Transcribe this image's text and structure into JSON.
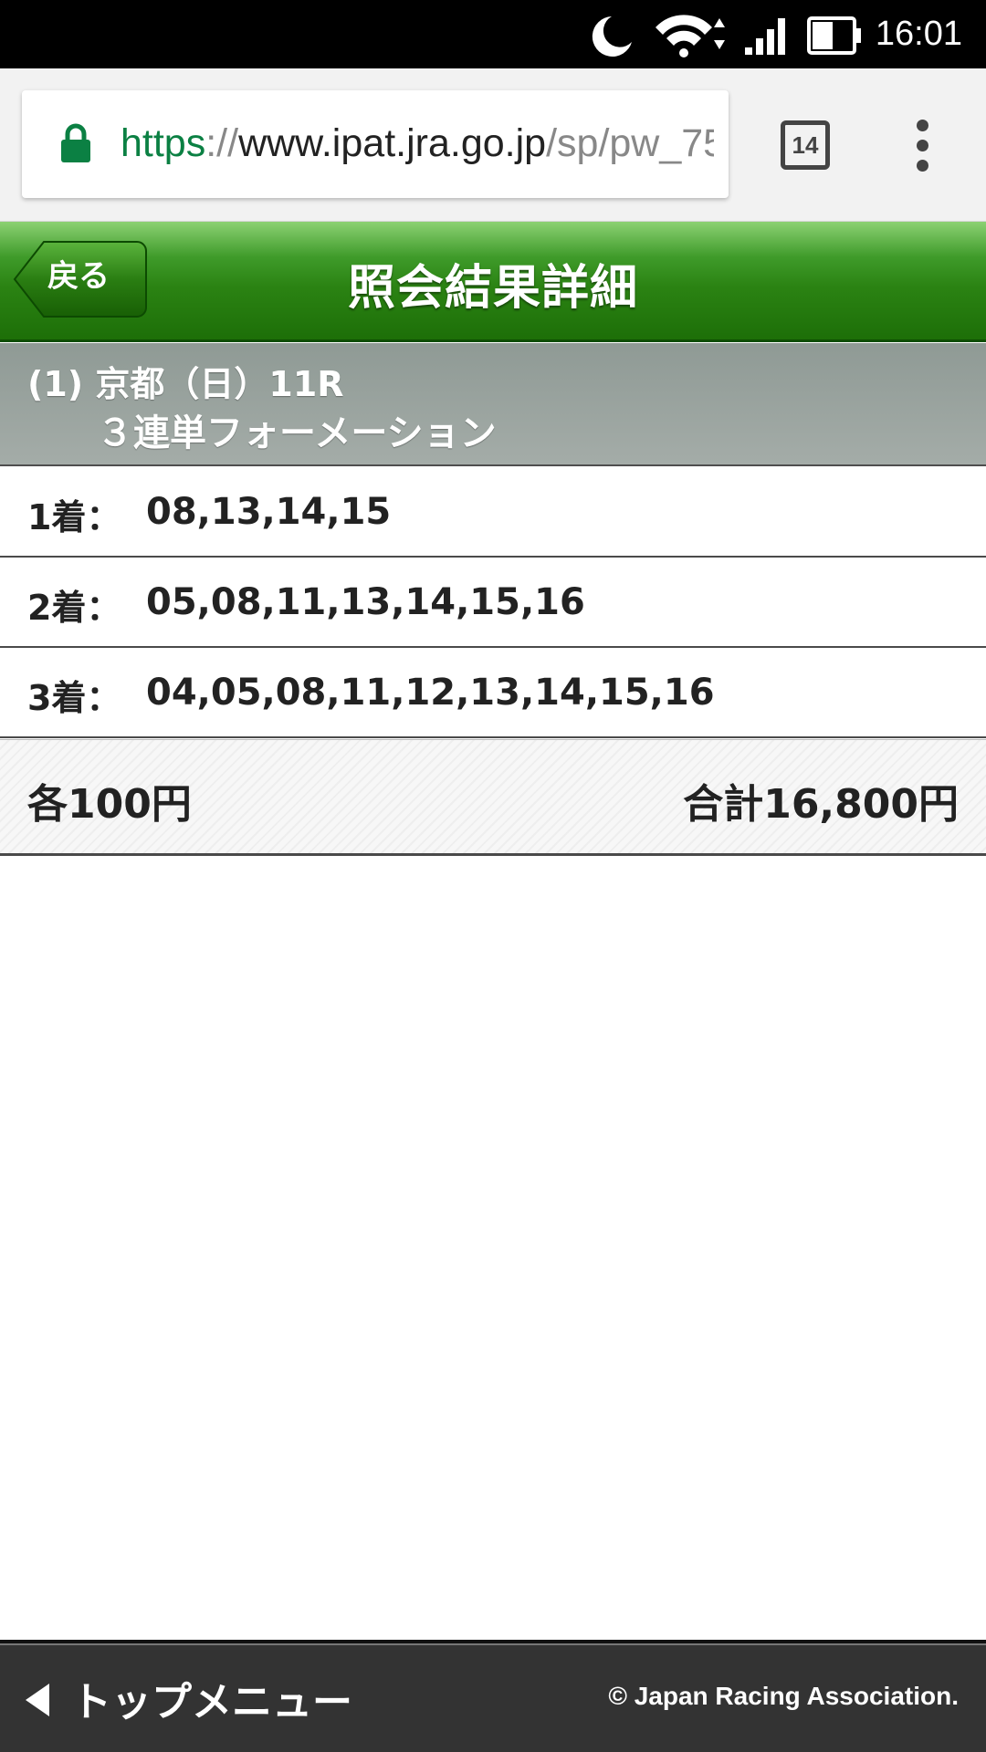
{
  "status_bar": {
    "time": "16:01",
    "icons": [
      "moon-icon",
      "wifi-icon",
      "signal-icon",
      "battery-icon"
    ]
  },
  "browser": {
    "url": {
      "scheme": "https",
      "separator": "://",
      "host": "www.ipat.jra.go.jp",
      "path": "/sp/pw_75"
    },
    "tab_count": "14"
  },
  "header": {
    "back_label": "戻る",
    "title": "照会結果詳細"
  },
  "race": {
    "line1": "(1) 京都（日）11R",
    "line2": "３連単フォーメーション"
  },
  "picks": [
    {
      "position": "1着：",
      "numbers": "08,13,14,15"
    },
    {
      "position": "2着：",
      "numbers": "05,08,11,13,14,15,16"
    },
    {
      "position": "3着：",
      "numbers": "04,05,08,11,12,13,14,15,16"
    }
  ],
  "summary": {
    "each": "各100円",
    "total": "合計16,800円"
  },
  "footer": {
    "top_menu_label": "トップメニュー",
    "copyright": "© Japan Racing Association."
  },
  "colors": {
    "header_green": "#2b8313",
    "race_bar_grey": "#9aa39f",
    "footer_dark": "#333333",
    "url_scheme_green": "#0b8043"
  }
}
